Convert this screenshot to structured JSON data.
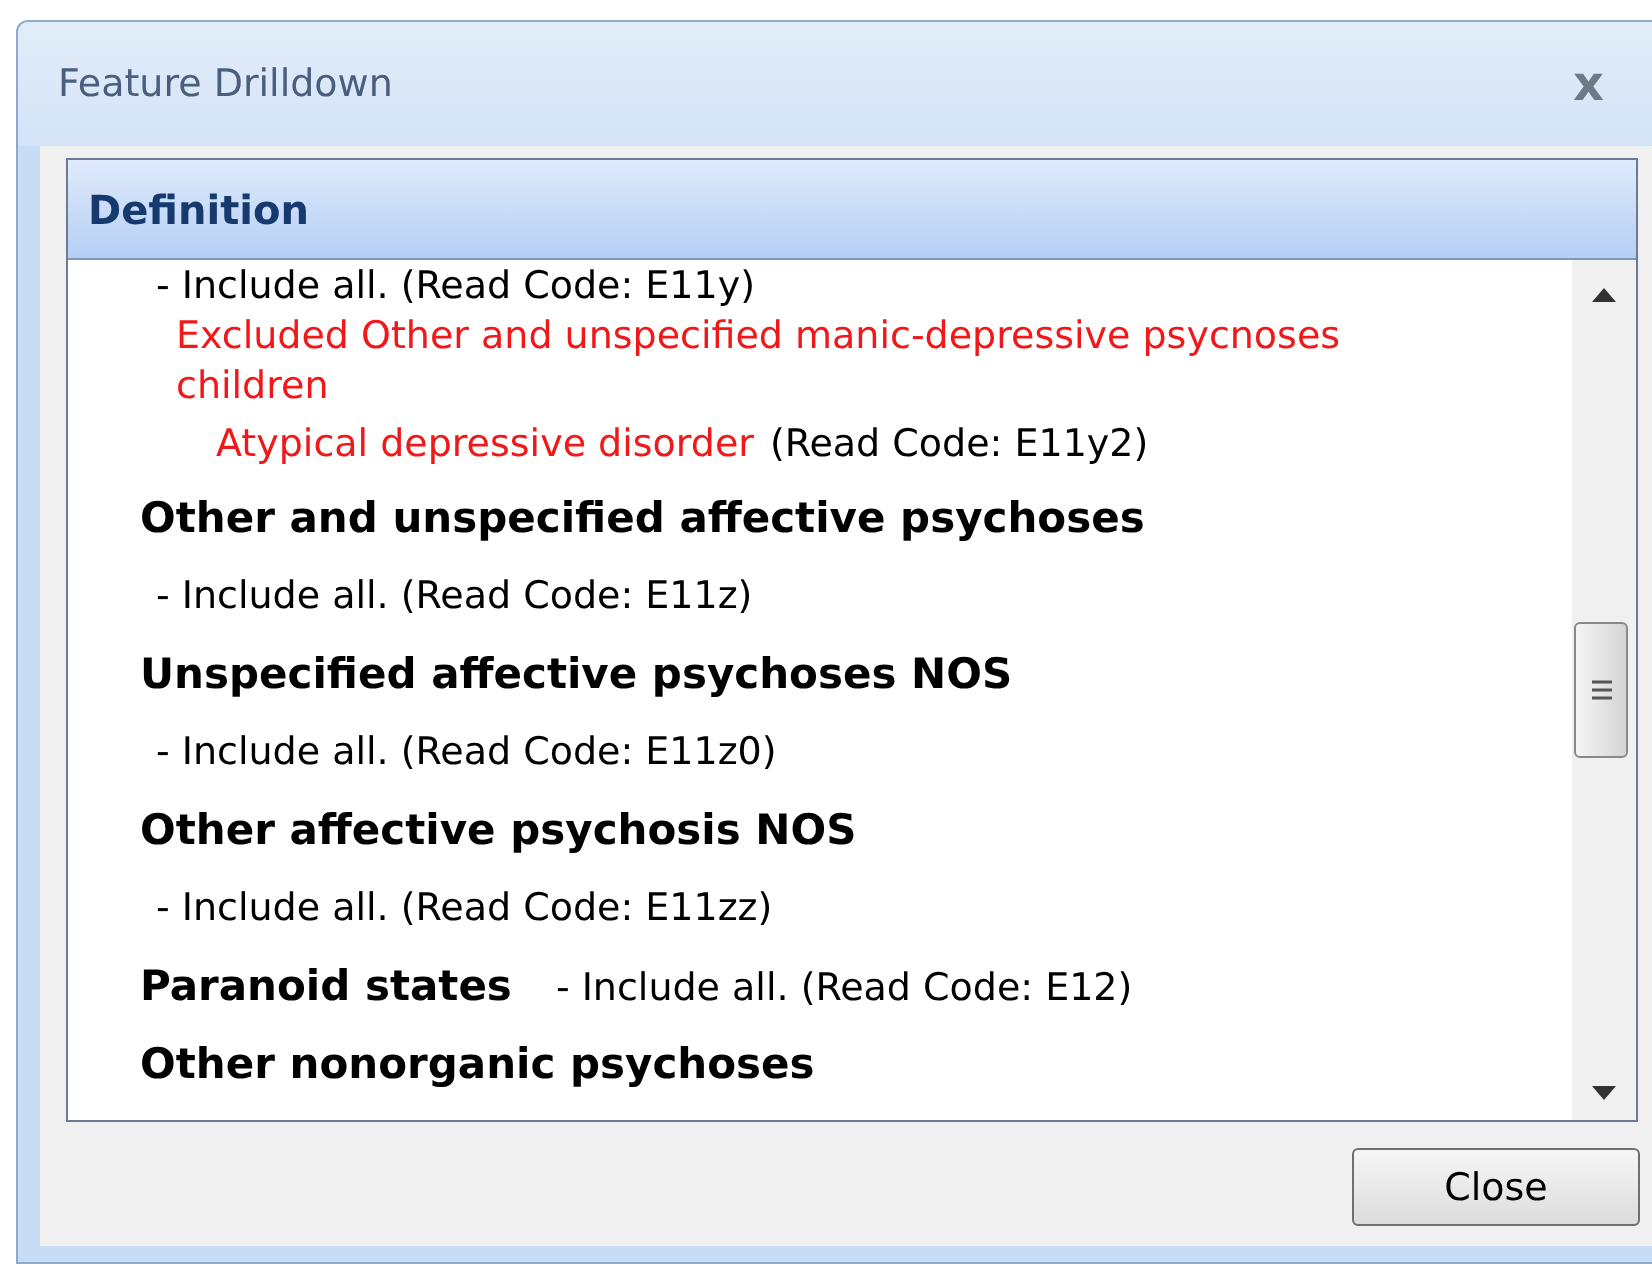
{
  "window": {
    "title": "Feature Drilldown",
    "close_glyph": "x"
  },
  "panel": {
    "title": "Definition"
  },
  "lines": [
    {
      "kind": "include",
      "text": "- Include all. (Read Code: E11y)"
    },
    {
      "kind": "excluded",
      "text": "Excluded Other and unspecified manic-depressive psycnoses children"
    },
    {
      "kind": "excluded_item",
      "text": "Atypical depressive disorder",
      "code": "(Read Code: E11y2)"
    },
    {
      "kind": "heading",
      "text": "Other and unspecified affective psychoses"
    },
    {
      "kind": "include",
      "text": "- Include all. (Read Code: E11z)"
    },
    {
      "kind": "heading",
      "text": "Unspecified affective psychoses NOS"
    },
    {
      "kind": "include",
      "text": "- Include all. (Read Code: E11z0)"
    },
    {
      "kind": "heading",
      "text": "Other affective psychosis NOS"
    },
    {
      "kind": "include",
      "text": "- Include all. (Read Code: E11zz)"
    },
    {
      "kind": "heading",
      "text": "Paranoid states",
      "code": "- Include all. (Read Code: E12)"
    },
    {
      "kind": "heading",
      "text": "Other nonorganic psychoses"
    }
  ],
  "buttons": [
    {
      "label": "Close"
    }
  ]
}
